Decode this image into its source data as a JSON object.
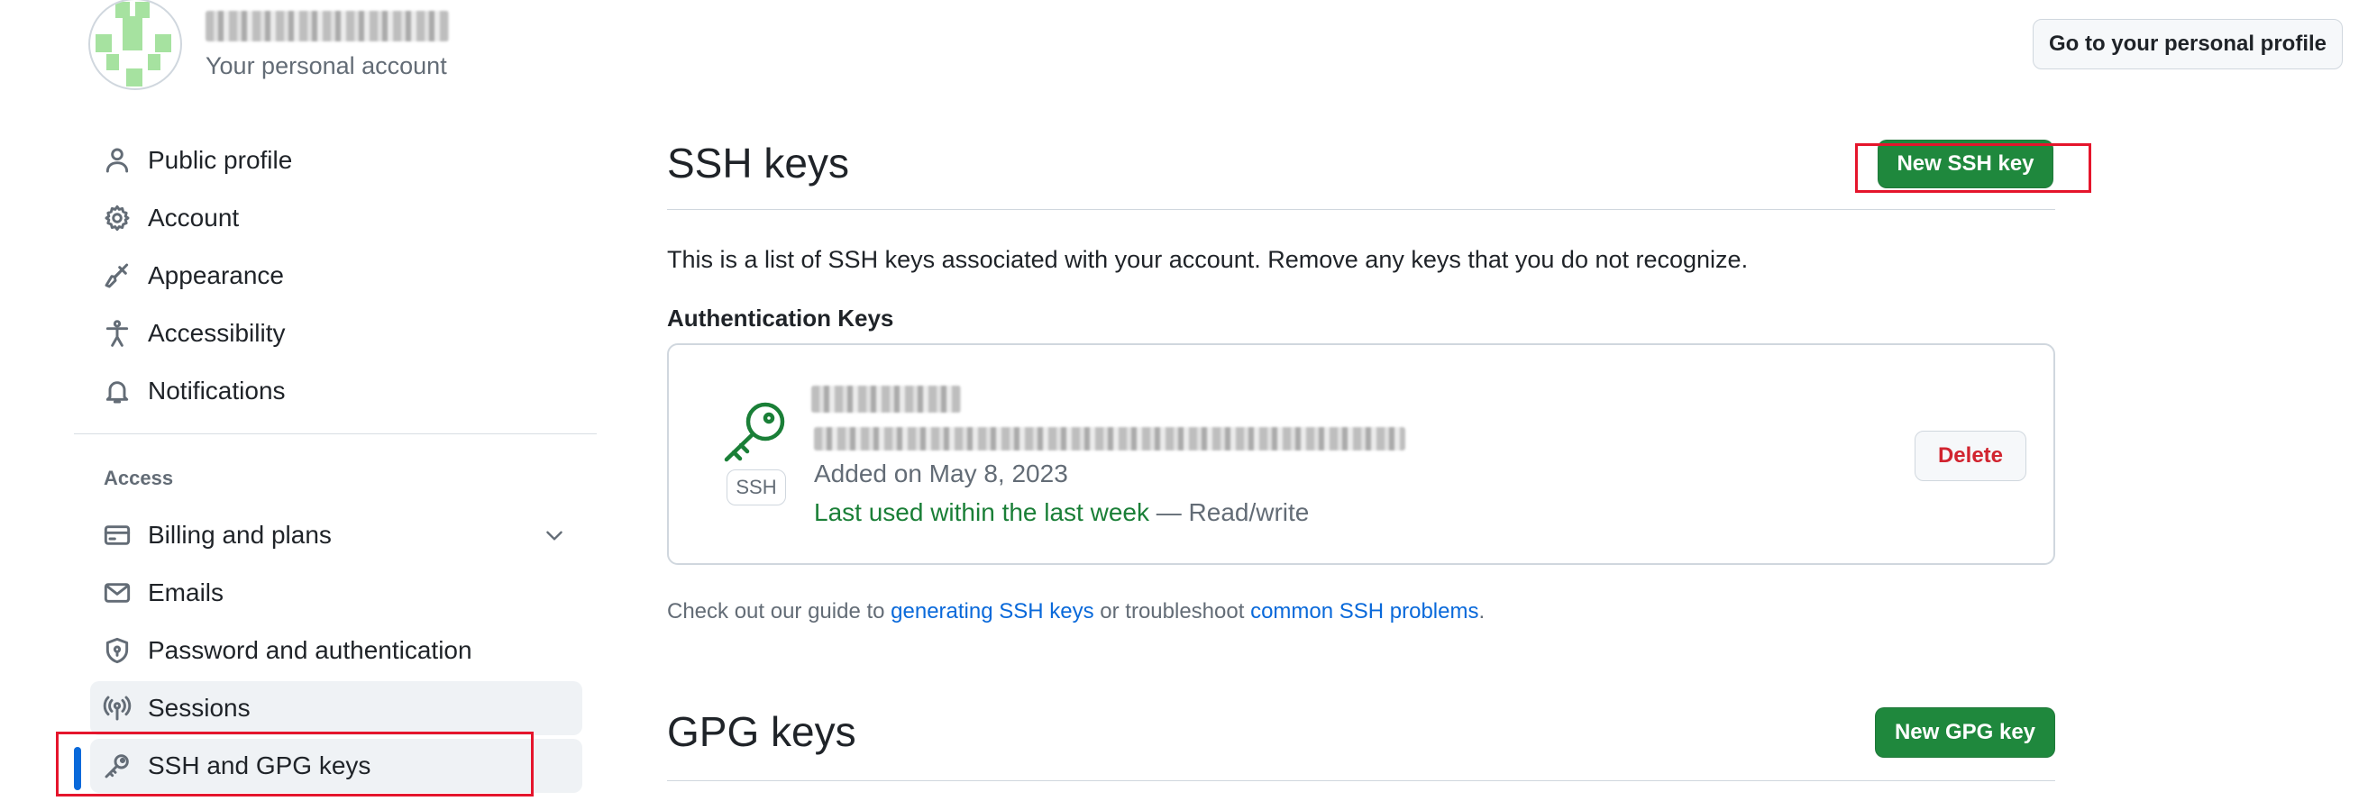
{
  "account": {
    "name_blurred": "redacted",
    "subtitle": "Your personal account",
    "profile_button": "Go to your personal profile"
  },
  "sidebar": {
    "items": [
      {
        "label": "Public profile",
        "icon": "person-icon"
      },
      {
        "label": "Account",
        "icon": "gear-icon"
      },
      {
        "label": "Appearance",
        "icon": "paintbrush-icon"
      },
      {
        "label": "Accessibility",
        "icon": "accessibility-icon"
      },
      {
        "label": "Notifications",
        "icon": "bell-icon"
      }
    ],
    "access_label": "Access",
    "access_items": [
      {
        "label": "Billing and plans",
        "icon": "credit-card-icon"
      },
      {
        "label": "Emails",
        "icon": "mail-icon"
      },
      {
        "label": "Password and authentication",
        "icon": "shield-lock-icon"
      },
      {
        "label": "Sessions",
        "icon": "broadcast-icon"
      },
      {
        "label": "SSH and GPG keys",
        "icon": "key-icon"
      }
    ]
  },
  "ssh": {
    "heading": "SSH keys",
    "new_button": "New SSH key",
    "description": "This is a list of SSH keys associated with your account. Remove any keys that you do not recognize.",
    "auth_heading": "Authentication Keys",
    "key": {
      "badge": "SSH",
      "added": "Added on May 8, 2023",
      "last_used": "Last used within the last week",
      "access": " — Read/write",
      "delete_button": "Delete"
    },
    "guide": {
      "prefix": "Check out our guide to ",
      "link1": "generating SSH keys",
      "middle": " or troubleshoot ",
      "link2": "common SSH problems",
      "suffix": "."
    }
  },
  "gpg": {
    "heading": "GPG keys",
    "new_button": "New GPG key"
  },
  "colors": {
    "green": "#1f883d",
    "link": "#0969da",
    "danger": "#d1242f",
    "highlight_box": "#e5152c"
  }
}
